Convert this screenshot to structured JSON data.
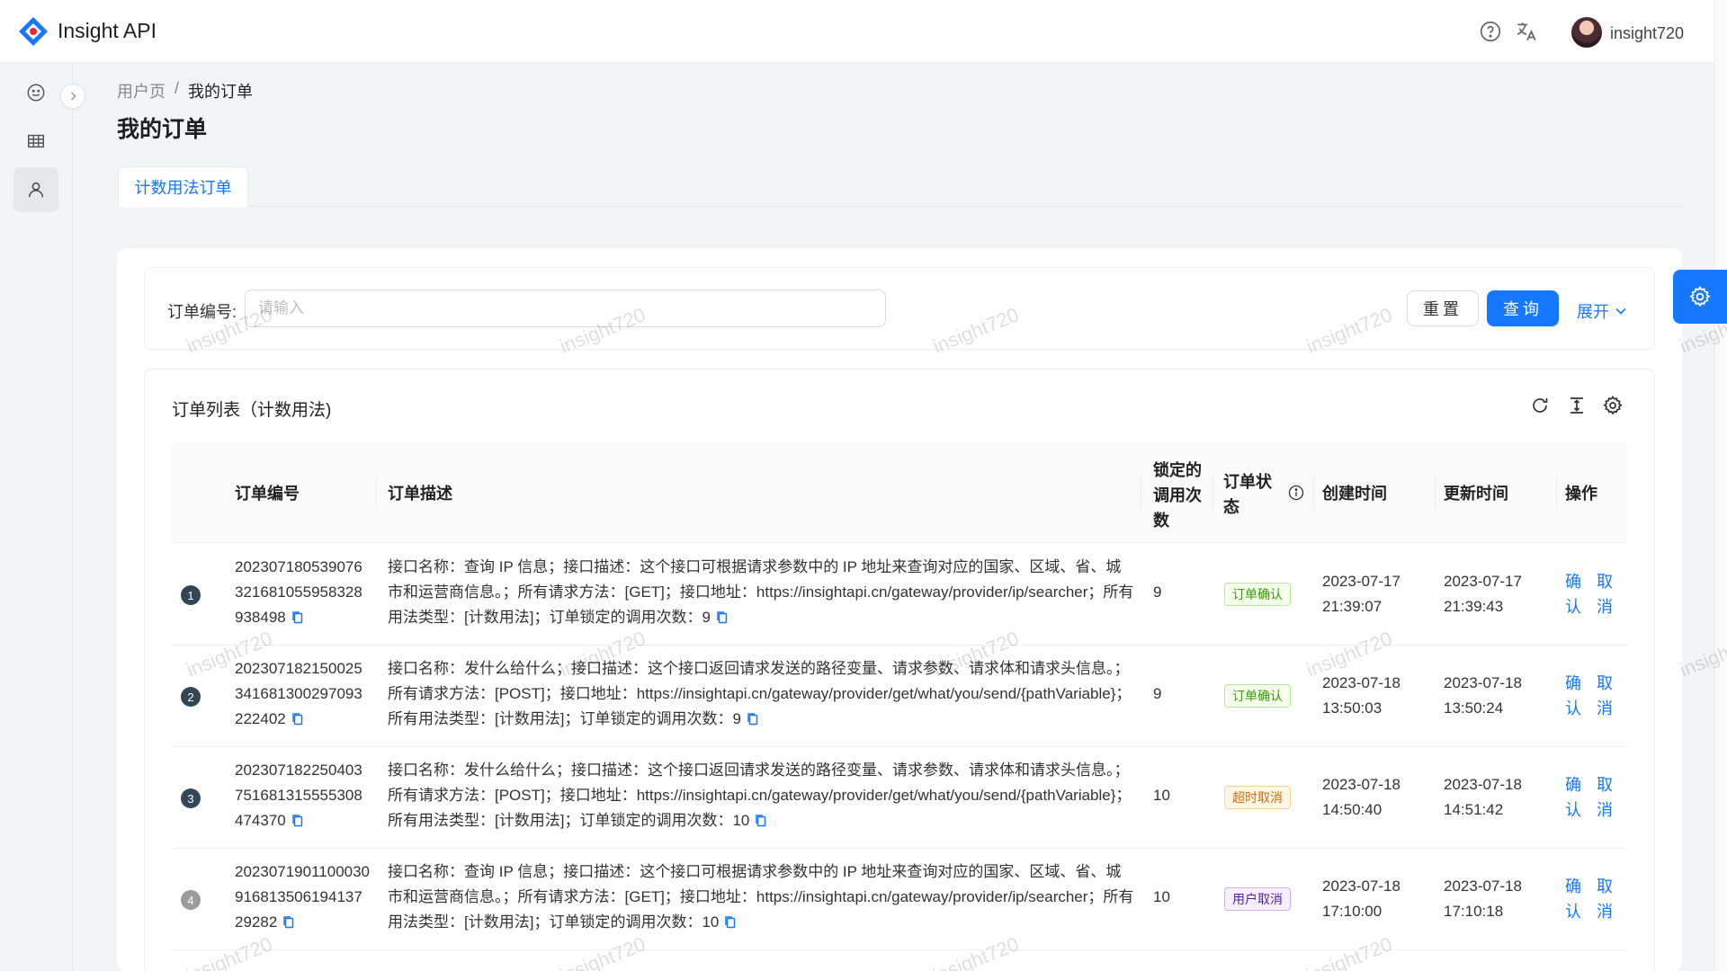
{
  "app": {
    "title": "Insight API"
  },
  "header": {
    "username": "insight720"
  },
  "breadcrumb": {
    "parent": "用户页",
    "separator": "/",
    "current": "我的订单"
  },
  "page": {
    "title": "我的订单"
  },
  "tabs": [
    {
      "label": "计数用法订单",
      "active": true
    }
  ],
  "search": {
    "label": "订单编号:",
    "placeholder": "请输入",
    "value": "",
    "reset_label": "重置",
    "query_label": "查询",
    "expand_label": "展开"
  },
  "table": {
    "title": "订单列表（计数用法)",
    "columns": {
      "order_no": "订单编号",
      "description": "订单描述",
      "locked_calls_1": "锁定的",
      "locked_calls_2": "调用次",
      "locked_calls_3": "数",
      "status_1": "订单状",
      "status_2": "态",
      "created": "创建时间",
      "updated": "更新时间",
      "actions": "操作"
    },
    "rows": [
      {
        "index": "1",
        "order_no": "202307180539076321681055958328938498",
        "desc": "接口名称：查询 IP 信息；接口描述：这个接口可根据请求参数中的 IP 地址来查询对应的国家、区域、省、城市和运营商信息。；所有请求方法：[GET]；接口地址：https://insightapi.cn/gateway/provider/ip/searcher；所有用法类型：[计数用法]；订单锁定的调用次数：9",
        "locked": "9",
        "status": "订单确认",
        "created_date": "2023-07-17",
        "created_time": "21:39:07",
        "updated_date": "2023-07-17",
        "updated_time": "21:39:43",
        "confirm": "确认",
        "cancel": "取消"
      },
      {
        "index": "2",
        "order_no": "202307182150025341681300297093222402",
        "desc": "接口名称：发什么给什么；接口描述：这个接口返回请求发送的路径变量、请求参数、请求体和请求头信息。；所有请求方法：[POST]；接口地址：https://insightapi.cn/gateway/provider/get/what/you/send/{pathVariable}；所有用法类型：[计数用法]；订单锁定的调用次数：9",
        "locked": "9",
        "status": "订单确认",
        "created_date": "2023-07-18",
        "created_time": "13:50:03",
        "updated_date": "2023-07-18",
        "updated_time": "13:50:24",
        "confirm": "确认",
        "cancel": "取消"
      },
      {
        "index": "3",
        "order_no": "202307182250403751681315555308474370",
        "desc": "接口名称：发什么给什么；接口描述：这个接口返回请求发送的路径变量、请求参数、请求体和请求头信息。；所有请求方法：[POST]；接口地址：https://insightapi.cn/gateway/provider/get/what/you/send/{pathVariable}；所有用法类型：[计数用法]；订单锁定的调用次数：10",
        "locked": "10",
        "status": "超时取消",
        "created_date": "2023-07-18",
        "created_time": "14:50:40",
        "updated_date": "2023-07-18",
        "updated_time": "14:51:42",
        "confirm": "确认",
        "cancel": "取消"
      },
      {
        "index": "4",
        "order_no": "202307190110003091681350619413729282",
        "desc": "接口名称：查询 IP 信息；接口描述：这个接口可根据请求参数中的 IP 地址来查询对应的国家、区域、省、城市和运营商信息。；所有请求方法：[GET]；接口地址：https://insightapi.cn/gateway/provider/ip/searcher；所有用法类型：[计数用法]；订单锁定的调用次数：10",
        "locked": "10",
        "status": "用户取消",
        "created_date": "2023-07-18",
        "created_time": "17:10:00",
        "updated_date": "2023-07-18",
        "updated_time": "17:10:18",
        "confirm": "确认",
        "cancel": "取消"
      }
    ]
  },
  "watermark": "insight720",
  "colors": {
    "primary": "#1677ff",
    "status_confirm": "#389e0d",
    "status_timeout": "#d46b08",
    "status_user_cancel": "#531dab"
  }
}
